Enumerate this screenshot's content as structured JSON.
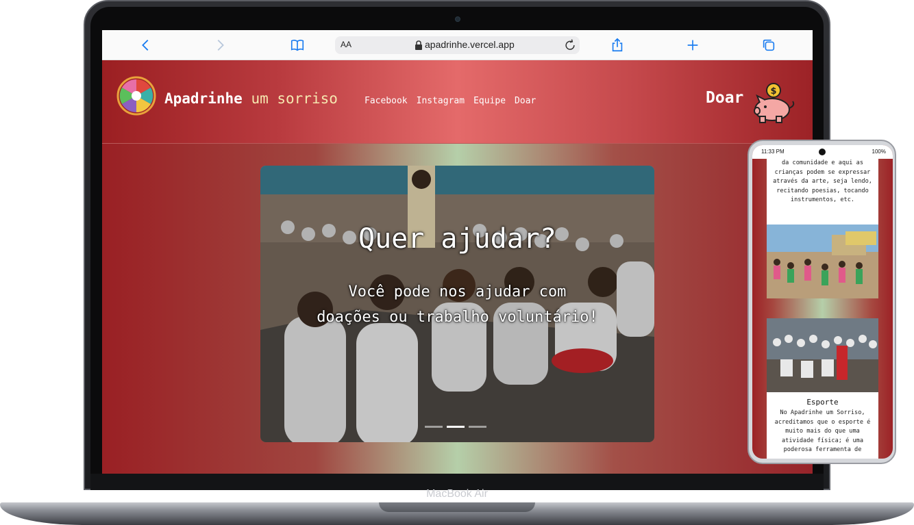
{
  "browser": {
    "url": "apadrinhe.vercel.app",
    "text_size_label": "AA"
  },
  "site": {
    "brand_main": "Apadrinhe",
    "brand_sub": "um sorriso",
    "nav": [
      "Facebook",
      "Instagram",
      "Equipe",
      "Doar"
    ],
    "donate_label": "Doar",
    "piggy_coin": "$"
  },
  "hero": {
    "title": "Quer ajudar?",
    "text": "Você pode nos ajudar com doações ou trabalho voluntário!",
    "slide_count": 3,
    "active_slide": 2
  },
  "laptop": {
    "brand": "MacBook Air"
  },
  "phone": {
    "time": "11:33 PM",
    "battery": "100%",
    "text_top": "da comunidade e aqui as crianças podem se expressar através da arte, seja lendo, recitando poesias, tocando instrumentos, etc.",
    "sport_title": "Esporte",
    "sport_text": "No Apadrinhe um Sorriso, acreditamos que o esporte é muito mais do que uma atividade física; é uma poderosa ferramenta de"
  }
}
